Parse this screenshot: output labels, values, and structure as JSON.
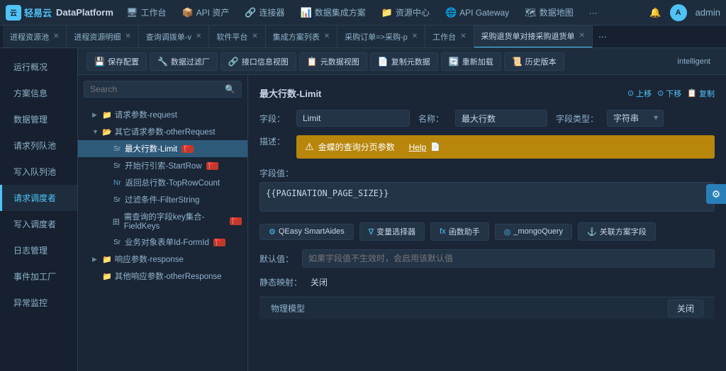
{
  "app": {
    "logo_text": "轻易云",
    "platform_name": "DataPlatform",
    "admin_label": "admin"
  },
  "top_nav": {
    "items": [
      {
        "id": "workbench",
        "icon": "🖥",
        "label": "工作台"
      },
      {
        "id": "api_assets",
        "icon": "📦",
        "label": "API 资产"
      },
      {
        "id": "connector",
        "icon": "🔗",
        "label": "连接器"
      },
      {
        "id": "integration",
        "icon": "📊",
        "label": "数据集成方案"
      },
      {
        "id": "resource",
        "icon": "📁",
        "label": "资源中心"
      },
      {
        "id": "api_gateway",
        "icon": "🌐",
        "label": "API Gateway"
      },
      {
        "id": "data_map",
        "icon": "🗺",
        "label": "数据地图"
      },
      {
        "id": "more",
        "icon": "···",
        "label": ""
      }
    ]
  },
  "tabs": [
    {
      "id": "tab1",
      "label": "进程资源池",
      "active": false
    },
    {
      "id": "tab2",
      "label": "进程资源明细",
      "active": false
    },
    {
      "id": "tab3",
      "label": "查询调拨单-v",
      "active": false
    },
    {
      "id": "tab4",
      "label": "软件平台",
      "active": false
    },
    {
      "id": "tab5",
      "label": "集成方案列表",
      "active": false
    },
    {
      "id": "tab6",
      "label": "采购订单=>采购-p",
      "active": false
    },
    {
      "id": "tab7",
      "label": "工作台",
      "active": false
    },
    {
      "id": "tab8",
      "label": "采购退货单对接采购退货单",
      "active": true
    }
  ],
  "toolbar": {
    "btns": [
      {
        "id": "save-config",
        "icon": "💾",
        "label": "保存配置"
      },
      {
        "id": "data-filter",
        "icon": "🔧",
        "label": "数据过滤厂"
      },
      {
        "id": "interface-view",
        "icon": "🔗",
        "label": "接口信息视图"
      },
      {
        "id": "meta-view",
        "icon": "📋",
        "label": "元数据视图"
      },
      {
        "id": "copy-meta",
        "icon": "📄",
        "label": "复制元数据"
      },
      {
        "id": "reload",
        "icon": "🔄",
        "label": "重新加载"
      },
      {
        "id": "history",
        "icon": "📜",
        "label": "历史版本"
      }
    ],
    "tab_intelligent": "intelligent"
  },
  "sidebar": {
    "items": [
      {
        "id": "overview",
        "label": "运行概况",
        "active": false
      },
      {
        "id": "solution",
        "label": "方案信息",
        "active": false
      },
      {
        "id": "data-mgmt",
        "label": "数据管理",
        "active": false
      },
      {
        "id": "request-pool",
        "label": "请求列队池",
        "active": false
      },
      {
        "id": "write-pool",
        "label": "写入队列池",
        "active": false
      },
      {
        "id": "requester",
        "label": "请求调度者",
        "active": true
      },
      {
        "id": "writer",
        "label": "写入调度者",
        "active": false
      },
      {
        "id": "log-mgmt",
        "label": "日志管理",
        "active": false
      },
      {
        "id": "event-factory",
        "label": "事件加工厂",
        "active": false
      },
      {
        "id": "exception",
        "label": "异常监控",
        "active": false
      }
    ]
  },
  "tree": {
    "search_placeholder": "Search",
    "nodes": [
      {
        "id": "request-param",
        "level": 1,
        "icon": "folder",
        "arrow": "▶",
        "label": "请求参数-request",
        "selected": false
      },
      {
        "id": "other-request",
        "level": 1,
        "icon": "folder",
        "arrow": "▼",
        "label": "其它请求参数-otherRequest",
        "selected": false
      },
      {
        "id": "max-rows",
        "level": 2,
        "icon": "param",
        "label": "最大行数-Limit",
        "prefix": "Sr",
        "badge": "flag",
        "selected": true
      },
      {
        "id": "start-row",
        "level": 2,
        "icon": "param",
        "label": "开始行引索-StartRow",
        "prefix": "Sr",
        "badge": "flag",
        "selected": false
      },
      {
        "id": "top-row",
        "level": 2,
        "icon": "param",
        "label": "返回总行数-TopRowCount",
        "prefix": "Nr",
        "badge": "nr",
        "selected": false
      },
      {
        "id": "filter-string",
        "level": 2,
        "icon": "param",
        "label": "过滤条件-FilterString",
        "prefix": "Sr",
        "selected": false
      },
      {
        "id": "field-keys",
        "level": 2,
        "icon": "param",
        "label": "需查询的字段key集合-FieldKeys",
        "prefix": "田",
        "badge": "flag",
        "selected": false
      },
      {
        "id": "form-id",
        "level": 2,
        "icon": "param",
        "label": "业务对象表单Id-FormId",
        "prefix": "Sr",
        "badge": "flag",
        "selected": false
      },
      {
        "id": "response-param",
        "level": 1,
        "icon": "folder",
        "arrow": "▶",
        "label": "响应参数-response",
        "selected": false
      },
      {
        "id": "other-response",
        "level": 1,
        "icon": "folder",
        "label": "其他响应参数-otherResponse",
        "selected": false
      }
    ]
  },
  "detail": {
    "title": "最大行数-Limit",
    "actions": {
      "up": "上移",
      "down": "下移",
      "copy": "复制"
    },
    "field_label": "字段：",
    "field_value": "Limit",
    "name_label": "名称：",
    "name_value": "最大行数",
    "type_label": "字段类型：",
    "type_value": "字符串",
    "desc_label": "描述：",
    "desc_content": "金蝶的查询分页参数",
    "desc_help": "Help",
    "value_label": "字段值：",
    "value_content": "{{PAGINATION_PAGE_SIZE}}",
    "tool_buttons": [
      {
        "id": "qeasy-aide",
        "icon": "⚙",
        "label": "QEasy SmartAides"
      },
      {
        "id": "var-select",
        "icon": "∇",
        "label": "变量选择器"
      },
      {
        "id": "func-helper",
        "icon": "fx",
        "label": "函数助手"
      },
      {
        "id": "mongo-query",
        "icon": "◎",
        "label": "_mongoQuery"
      },
      {
        "id": "related-field",
        "icon": "⚓",
        "label": "关联方案字段"
      }
    ],
    "default_label": "默认值：",
    "default_placeholder": "如果字段值不生效时，会启用该默认值",
    "static_label": "静态映射：",
    "static_value": "关闭",
    "bottom_title": "物理模型",
    "bottom_close": "关闭"
  }
}
